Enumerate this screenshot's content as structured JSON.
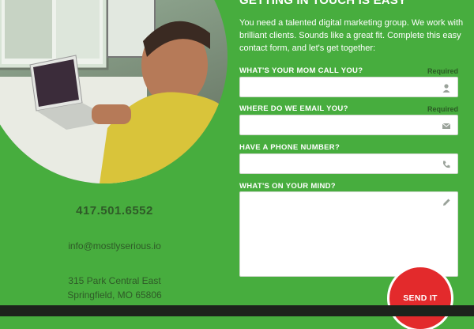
{
  "contact": {
    "phone": "417.501.6552",
    "email": "info@mostlyserious.io",
    "address_line1": "315 Park Central East",
    "address_line2": "Springfield, MO 65806"
  },
  "form": {
    "title": "GETTING IN TOUCH IS EASY",
    "intro": "You need a talented digital marketing group. We work with brilliant clients. Sounds like a great fit. Complete this easy contact form, and let's get together:",
    "fields": [
      {
        "label": "WHAT'S YOUR MOM CALL YOU?",
        "required": "Required",
        "icon": "user-icon"
      },
      {
        "label": "WHERE DO WE EMAIL YOU?",
        "required": "Required",
        "icon": "envelope-icon"
      },
      {
        "label": "HAVE A PHONE NUMBER?",
        "icon": "phone-icon"
      },
      {
        "label": "WHAT'S ON YOUR MIND?",
        "icon": "pencil-icon"
      }
    ],
    "send_label": "SEND IT"
  },
  "colors": {
    "background": "#47ad3e",
    "send_button": "#e32a2c",
    "footer_bar": "#1d231c"
  }
}
